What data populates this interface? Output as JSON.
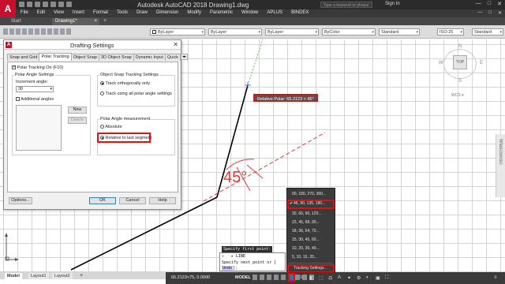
{
  "app": {
    "logo": "A",
    "title": "Autodesk AutoCAD 2018    Drawing1.dwg",
    "search_placeholder": "Type a keyword or phrase",
    "sign_in": "Sign In",
    "window_buttons": [
      "—",
      "□",
      "✕"
    ]
  },
  "menu": {
    "items": [
      "File",
      "Edit",
      "View",
      "Insert",
      "Format",
      "Tools",
      "Draw",
      "Dimension",
      "Modify",
      "Parametric",
      "Window",
      "APLUS",
      "BINDEX"
    ],
    "window_buttons": [
      "—",
      "□",
      "✕"
    ]
  },
  "tabs": {
    "start": "Start",
    "drawing": "Drawing1*",
    "close": "×",
    "add": "+"
  },
  "toolbar": {
    "layer": "ByLayer",
    "linetype": "ByLayer",
    "lineweight": "ByLayer",
    "color": "ByColor",
    "text_style": "Standard",
    "dim_style": "ISO-25",
    "table_style": "Standard"
  },
  "dialog": {
    "title": "Drafting Settings",
    "close": "✕",
    "tabs": [
      "Snap and Grid",
      "Polar Tracking",
      "Object Snap",
      "3D Object Snap",
      "Dynamic Input",
      "Quick"
    ],
    "active_tab": "Polar Tracking",
    "polar_on": "Polar Tracking On (F10)",
    "angle_settings": "Polar Angle Settings",
    "increment_label": "Increment angle:",
    "increment_value": "30",
    "additional_angles": "Additional angles",
    "new_btn": "New",
    "delete_btn": "Delete",
    "ost_title": "Object Snap Tracking Settings",
    "ost_orth": "Track orthogonally only",
    "ost_all": "Track using all polar angle settings",
    "measure_title": "Polar Angle measurement",
    "absolute": "Absolute",
    "relative": "Relative to last segment",
    "options_btn": "Options...",
    "ok_btn": "OK",
    "cancel_btn": "Cancel",
    "help_btn": "Help"
  },
  "canvas": {
    "polar_tooltip": "Relative Polar: 65.2123 < 45°",
    "angle_label": "45°"
  },
  "viewcube": {
    "north": "N",
    "south": "S",
    "west": "W",
    "east": "E",
    "top": "TOP",
    "wcs": "WCS ▾"
  },
  "nav": {
    "label": "Właściwości"
  },
  "polar_menu": {
    "items": [
      {
        "label": "90, 180, 270, 360...",
        "selected": false
      },
      {
        "label": "45, 90, 135, 180...",
        "selected": true
      },
      {
        "label": "30, 60, 90, 120...",
        "selected": false
      },
      {
        "label": "23, 45, 68, 90...",
        "selected": false
      },
      {
        "label": "18, 36, 54, 72...",
        "selected": false
      },
      {
        "label": "15, 30, 45, 60...",
        "selected": false
      },
      {
        "label": "10, 20, 30, 40...",
        "selected": false
      },
      {
        "label": "5, 10, 15, 20...",
        "selected": false
      }
    ],
    "settings": "Tracking Settings..."
  },
  "command": {
    "history": "Specify first point:",
    "line1": "LINE",
    "line2": "Specify next point or [",
    "undo": "Undo",
    "line2_end": "]:"
  },
  "layouts": {
    "model": "Model",
    "l1": "Layout1",
    "l2": "Layout2",
    "add": "+"
  },
  "status": {
    "coords": "65.2123<75, 0.0000",
    "model": "MODEL"
  },
  "colors": {
    "accent_red": "#dd1111",
    "polar_tracking": "#2f6fb7",
    "dialog_bg": "#f0f0f0"
  }
}
